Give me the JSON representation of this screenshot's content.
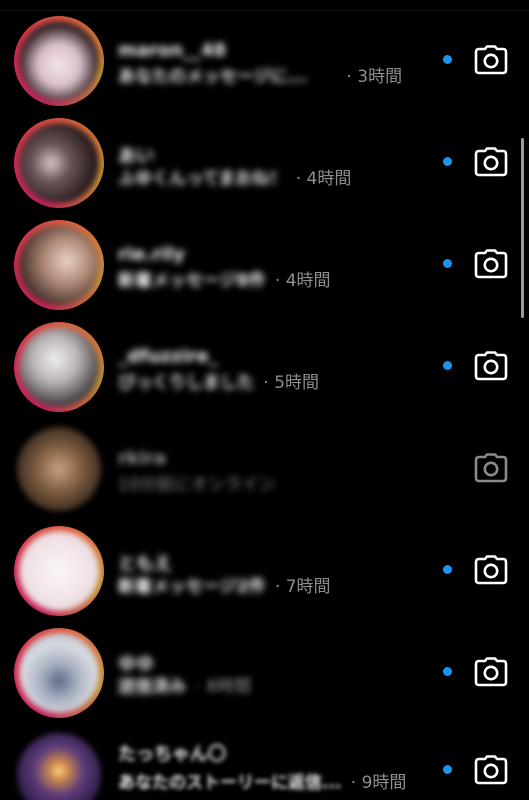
{
  "conversations": [
    {
      "username": "maron__48",
      "message": "あなたのメッセージに...",
      "separator": "·",
      "time": "3時間",
      "unread": true,
      "ring": true
    },
    {
      "username": "あい",
      "message": "ふゆくんってまおね！",
      "separator": "·",
      "time": "4時間",
      "unread": true,
      "ring": true
    },
    {
      "username": "rie.rily",
      "message": "新着メッセージ8件",
      "separator": "·",
      "time": "4時間",
      "unread": true,
      "ring": true
    },
    {
      "username": "_dfuzzire_",
      "message": "びっくりしました",
      "separator": "·",
      "time": "5時間",
      "unread": true,
      "ring": true
    },
    {
      "username": "rkira",
      "message": "10分前にオンライン",
      "separator": "",
      "time": "",
      "unread": false,
      "ring": false
    },
    {
      "username": "ともえ",
      "message": "新着メッセージ2件",
      "separator": "·",
      "time": "7時間",
      "unread": true,
      "ring": true
    },
    {
      "username": "ゆゆ",
      "message": "送信済み",
      "separator": "·",
      "time": "8時間",
      "unread": true,
      "ring": true
    },
    {
      "username": "たっちゃん〇",
      "message": "あなたのストーリーに返信...",
      "separator": "·",
      "time": "9時間",
      "unread": true,
      "ring": false
    }
  ],
  "icons": {
    "camera": "camera-icon",
    "unread": "unread-dot"
  },
  "colors": {
    "background": "#000000",
    "unread_dot": "#1b95f4",
    "ring_start": "#c81e5b",
    "ring_end": "#c2902f",
    "secondary_text": "#8e8e8e"
  }
}
